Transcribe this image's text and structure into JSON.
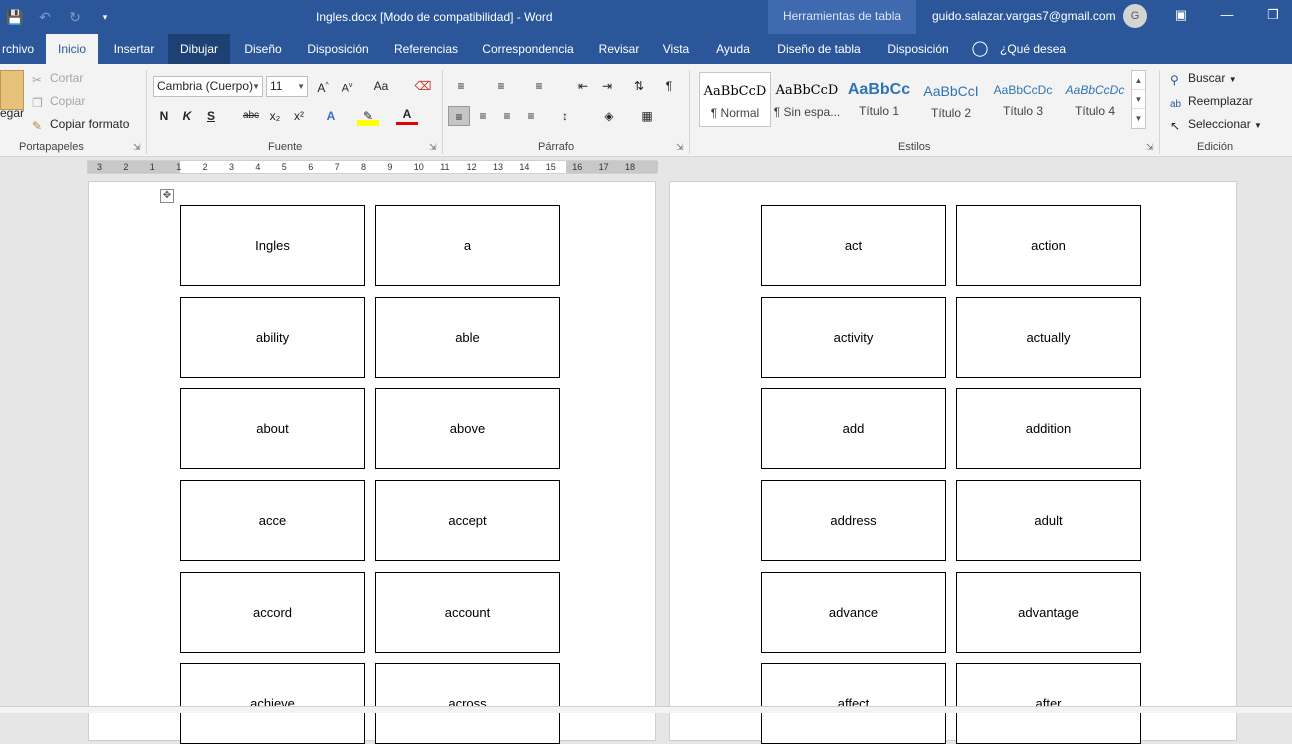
{
  "window": {
    "title": "Ingles.docx [Modo de compatibilidad]  -  Word",
    "contextual_tab_group": "Herramientas de tabla",
    "account_email": "guido.salazar.vargas7@gmail.com",
    "avatar_initial": "G"
  },
  "quick_access": [
    "save-icon",
    "undo-icon",
    "redo-icon",
    "customize-icon"
  ],
  "tabs": [
    {
      "label": "rchivo"
    },
    {
      "label": "Inicio"
    },
    {
      "label": "Insertar"
    },
    {
      "label": "Dibujar"
    },
    {
      "label": "Diseño"
    },
    {
      "label": "Disposición"
    },
    {
      "label": "Referencias"
    },
    {
      "label": "Correspondencia"
    },
    {
      "label": "Revisar"
    },
    {
      "label": "Vista"
    },
    {
      "label": "Ayuda"
    },
    {
      "label": "Diseño de tabla"
    },
    {
      "label": "Disposición"
    },
    {
      "label": "¿Qué desea hacer?"
    }
  ],
  "ribbon": {
    "clipboard": {
      "paste_label": "egar",
      "cut_label": "Cortar",
      "copy_label": "Copiar",
      "format_painter_label": "Copiar formato",
      "group_label": "Portapapeles"
    },
    "font": {
      "font_name": "Cambria (Cuerpo)",
      "font_size": "11",
      "group_label": "Fuente",
      "bold": "N",
      "italic": "K",
      "underline": "S",
      "strike": "abc",
      "subscript": "x₂",
      "superscript": "x²",
      "grow": "A^",
      "shrink": "A˅",
      "case": "Aa"
    },
    "paragraph": {
      "group_label": "Párrafo"
    },
    "styles": {
      "group_label": "Estilos",
      "items": [
        {
          "sample": "AaBbCcD",
          "name": "¶ Normal"
        },
        {
          "sample": "AaBbCcD",
          "name": "¶ Sin espa..."
        },
        {
          "sample": "AaBbCc",
          "name": "Título 1"
        },
        {
          "sample": "AaBbCcI",
          "name": "Título 2"
        },
        {
          "sample": "AaBbCcDc",
          "name": "Título 3"
        },
        {
          "sample": "AaBbCcDc",
          "name": "Título 4"
        }
      ]
    },
    "editing": {
      "group_label": "Edición",
      "find_label": "Buscar",
      "replace_label": "Reemplazar",
      "select_label": "Seleccionar"
    }
  },
  "ruler": {
    "labels": [
      "3",
      "2",
      "1",
      "1",
      "2",
      "3",
      "4",
      "5",
      "6",
      "7",
      "8",
      "9",
      "10",
      "11",
      "12",
      "13",
      "14",
      "15",
      "16",
      "17",
      "18"
    ]
  },
  "pages": [
    {
      "cards": [
        "Ingles",
        "a",
        "ability",
        "able",
        "about",
        "above",
        "acce",
        "accept",
        "accord",
        "account",
        "achieve",
        "across"
      ]
    },
    {
      "cards": [
        "act",
        "action",
        "activity",
        "actually",
        "add",
        "addition",
        "address",
        "adult",
        "advance",
        "advantage",
        "affect",
        "after"
      ]
    }
  ],
  "colors": {
    "accent": "#2b579a",
    "ribbon_bg": "#f3f3f3",
    "doc_bg": "#e6e6e6"
  }
}
